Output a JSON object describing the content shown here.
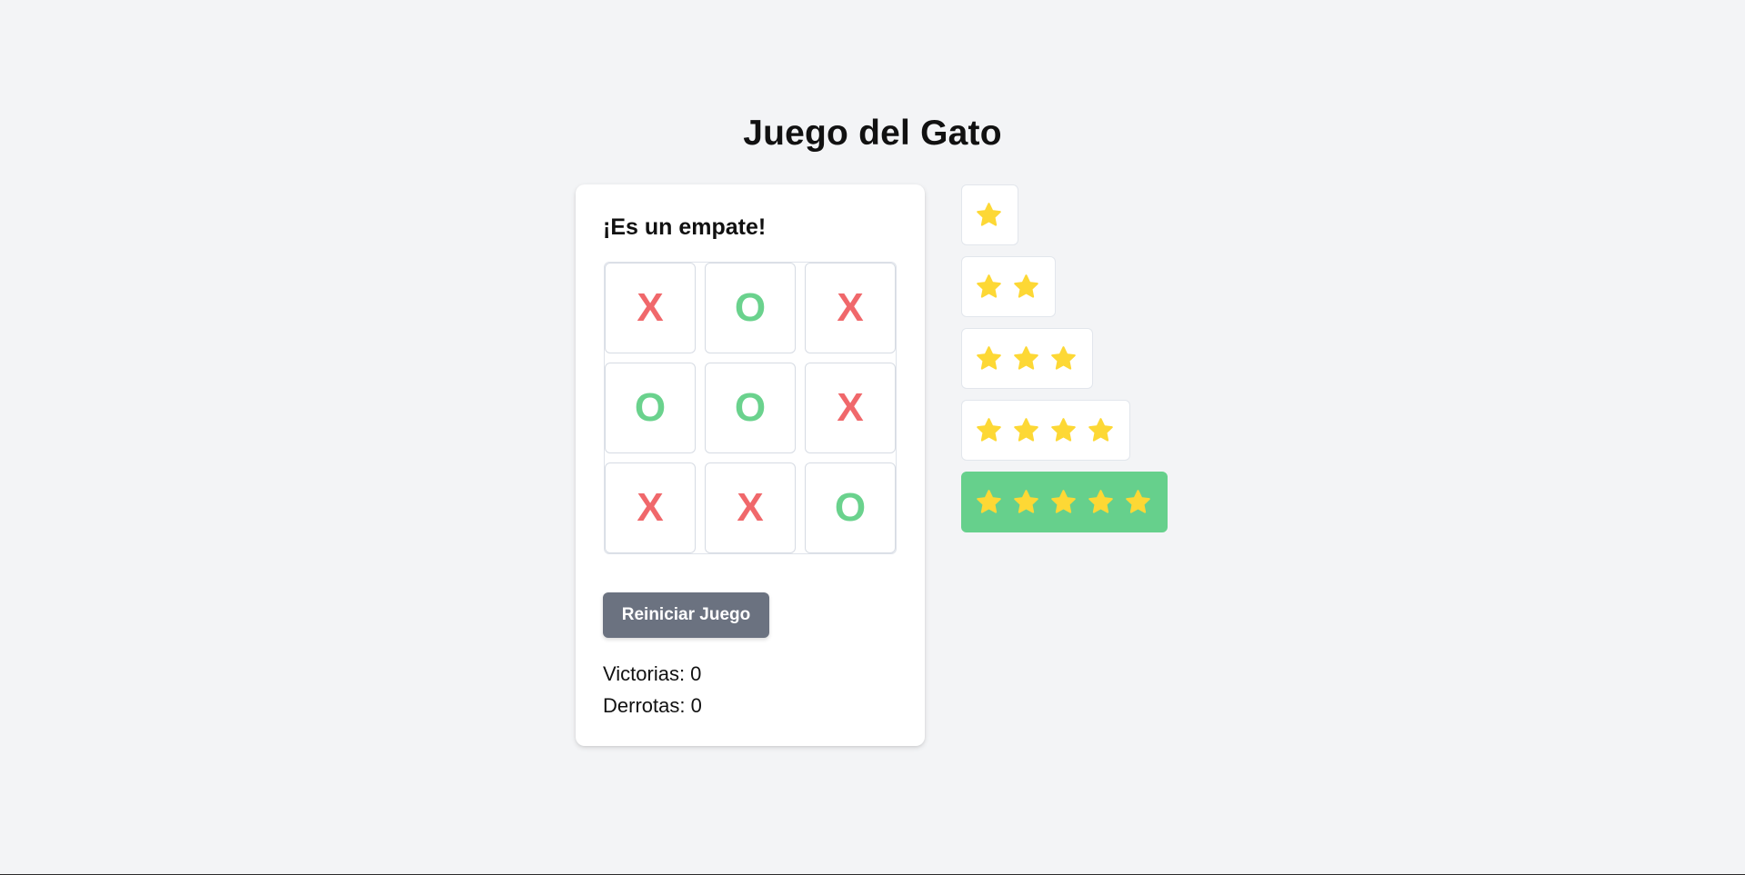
{
  "title": "Juego del Gato",
  "game": {
    "status": "¡Es un empate!",
    "board": [
      "X",
      "O",
      "X",
      "O",
      "O",
      "X",
      "X",
      "X",
      "O"
    ],
    "reset_label": "Reiniciar Juego",
    "wins_text": "Victorias: 0",
    "losses_text": "Derrotas: 0"
  },
  "ratings": {
    "options": [
      {
        "stars": 1
      },
      {
        "stars": 2
      },
      {
        "stars": 3
      },
      {
        "stars": 4
      },
      {
        "stars": 5
      }
    ],
    "selected": 5
  },
  "colors": {
    "x": "#f0686b",
    "o": "#6ad28d",
    "star": "#fdd835",
    "selected_bg": "#66d08c",
    "button_bg": "#6b7280"
  },
  "icons": {
    "star": "star-icon"
  }
}
